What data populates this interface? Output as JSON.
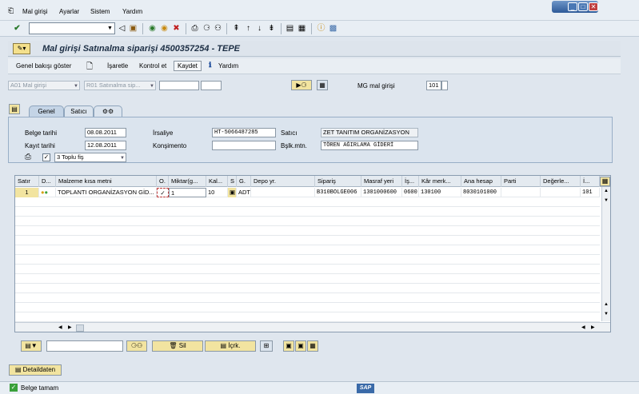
{
  "menubar": {
    "items": [
      "Mal girişi",
      "Ayarlar",
      "Sistem",
      "Yardım"
    ]
  },
  "toolbar": {
    "command_field_value": ""
  },
  "title": {
    "text": "Mal girişi Satınalma siparişi 4500357254 - TEPE"
  },
  "app_toolbar": {
    "overview": "Genel bakışı göster",
    "mark": "İşaretle",
    "check": "Kontrol et",
    "save": "Kaydet",
    "help": "Yardım"
  },
  "selection": {
    "action": "A01 Mal girişi",
    "reference": "R01 Satınalma sip...",
    "po_number": "",
    "item": "",
    "mvt_label": "MG mal girişi",
    "mvt_code": "101",
    "mvt_extra": ""
  },
  "tabs": [
    "Genel",
    "Satıcı"
  ],
  "header": {
    "doc_date_label": "Belge tarihi",
    "doc_date": "08.08.2011",
    "post_date_label": "Kayıt tarihi",
    "post_date": "12.08.2011",
    "delivery_note_label": "İrsaliye",
    "delivery_note": "HT-5066487285",
    "bill_of_lading_label": "Konşimento",
    "bill_of_lading": "",
    "vendor_label": "Satıcı",
    "vendor": "ZET TANITIM ORGANİZASYON",
    "header_text_label": "Bşlk.mtn.",
    "header_text": "TÖREN AĞIRLAMA GİDERİ",
    "print_option": "3 Toplu fiş"
  },
  "grid": {
    "columns": [
      "Satır",
      "D...",
      "Malzeme kısa metni",
      "O.",
      "Miktar(g...",
      "Kal...",
      "S",
      "G.",
      "Depo yr.",
      "Sipariş",
      "Masraf yeri",
      "İş...",
      "Kâr merk...",
      "Ana hesap",
      "Parti",
      "Değerle...",
      "İ..."
    ],
    "rows": [
      {
        "line": "1",
        "material_text": "TOPLANTI ORGANİZASYON GİD...",
        "ok": true,
        "qty": "1",
        "remaining": "10",
        "unit": "ADT",
        "storage": "",
        "order": "B310BOLGE006",
        "cost_center": "1301000600",
        "business_area": "0600",
        "profit_center": "130100",
        "gl_account": "8030101000",
        "batch": "",
        "valuation": "",
        "mvt": "101"
      }
    ]
  },
  "bottom_toolbar": {
    "search_value": "",
    "delete": "Sil",
    "contents": "İçrk."
  },
  "details_button": "Detaildaten",
  "status": {
    "text": "Belge tamam",
    "sap_logo": "SAP"
  },
  "colors": {
    "accent_yellow": "#f2e4a0",
    "title_blue": "#1c2e44",
    "panel_bg": "#dbe4ee"
  }
}
